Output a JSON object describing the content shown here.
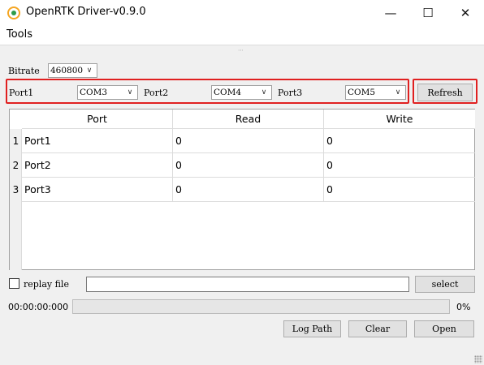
{
  "window": {
    "title": "OpenRTK Driver-v0.9.0",
    "minimize_glyph": "—",
    "maximize_glyph": "☐",
    "close_glyph": "✕",
    "icon": "app-logo-icon"
  },
  "menu": {
    "tools": "Tools"
  },
  "bitrate": {
    "label": "Bitrate",
    "value": "460800"
  },
  "ports": {
    "port1_label": "Port1",
    "port1_value": "COM3",
    "port2_label": "Port2",
    "port2_value": "COM4",
    "port3_label": "Port3",
    "port3_value": "COM5"
  },
  "refresh_label": "Refresh",
  "table": {
    "headers": [
      "Port",
      "Read",
      "Write"
    ],
    "rows": [
      {
        "num": "1",
        "port": "Port1",
        "read": "0",
        "write": "0"
      },
      {
        "num": "2",
        "port": "Port2",
        "read": "0",
        "write": "0"
      },
      {
        "num": "3",
        "port": "Port3",
        "read": "0",
        "write": "0"
      }
    ]
  },
  "replay": {
    "label": "replay file",
    "value": "",
    "select_label": "select",
    "checked": false
  },
  "status": {
    "timer": "00:00:00:000",
    "progress": 0,
    "progress_text": "0%"
  },
  "actions": {
    "log_path": "Log Path",
    "clear": "Clear",
    "open": "Open"
  },
  "colors": {
    "highlight": "#e02020",
    "accent_ring": "#f5a623",
    "accent_center": "#2e9c4a"
  },
  "arrow_glyph": "∨"
}
